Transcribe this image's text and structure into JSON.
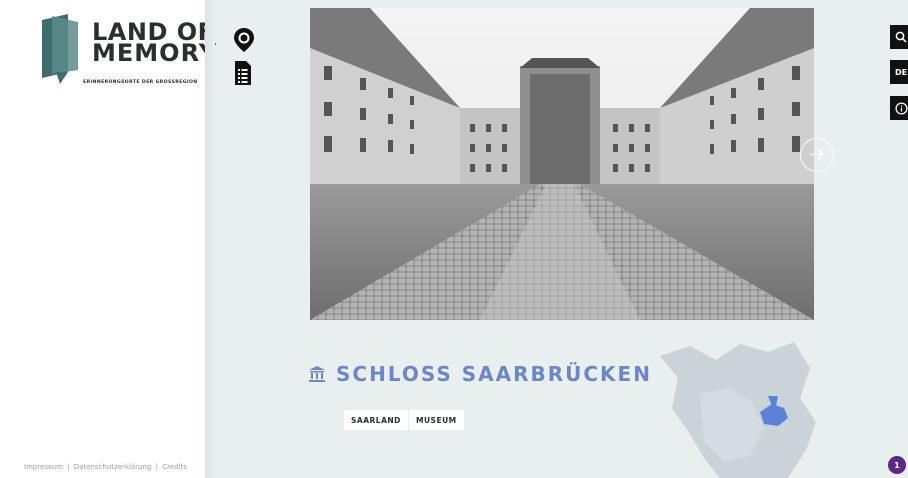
{
  "logo": {
    "line1": "LAND OF",
    "line2": "MEMORY",
    "subtitle": "ERINNERUNGSORTE DER GROSSREGION"
  },
  "footer": {
    "links": [
      "Impressum",
      "Datenschutzerklärung",
      "Credits"
    ],
    "separator": "|"
  },
  "toolbar": {
    "icons": [
      "map-pin-icon",
      "list-document-icon"
    ]
  },
  "utility": {
    "search_icon": "search-icon",
    "language": "DE",
    "info_icon": "info-icon"
  },
  "hero": {
    "image": "schloss-saarbruecken-courtyard-photo",
    "next_icon": "chevron-right-icon"
  },
  "place": {
    "icon": "museum-icon",
    "title": "SCHLOSS SAARBRÜCKEN",
    "tags": [
      "SAARLAND",
      "MUSEUM"
    ],
    "accent": "#6b86c9"
  },
  "map": {
    "highlight_color": "#5b82d6"
  },
  "notification": {
    "count": "1",
    "color": "#5b2a86"
  }
}
